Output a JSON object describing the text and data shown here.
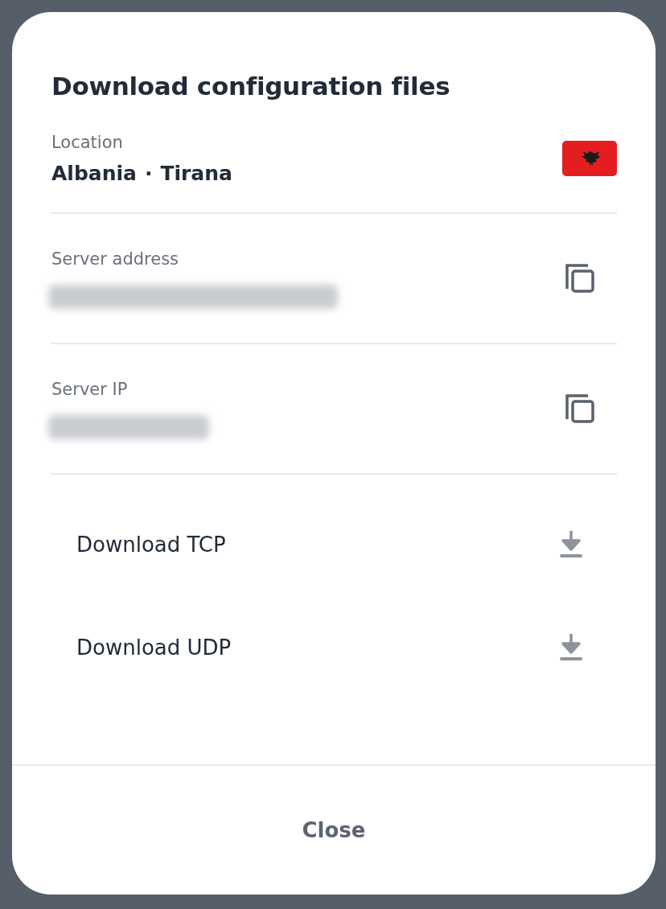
{
  "dialog": {
    "title": "Download configuration files",
    "location": {
      "label": "Location",
      "country": "Albania",
      "separator": "·",
      "city": "Tirana"
    },
    "fields": [
      {
        "label": "Server address"
      },
      {
        "label": "Server IP"
      }
    ],
    "downloads": [
      {
        "label": "Download TCP"
      },
      {
        "label": "Download UDP"
      }
    ],
    "close_button": "Close"
  }
}
